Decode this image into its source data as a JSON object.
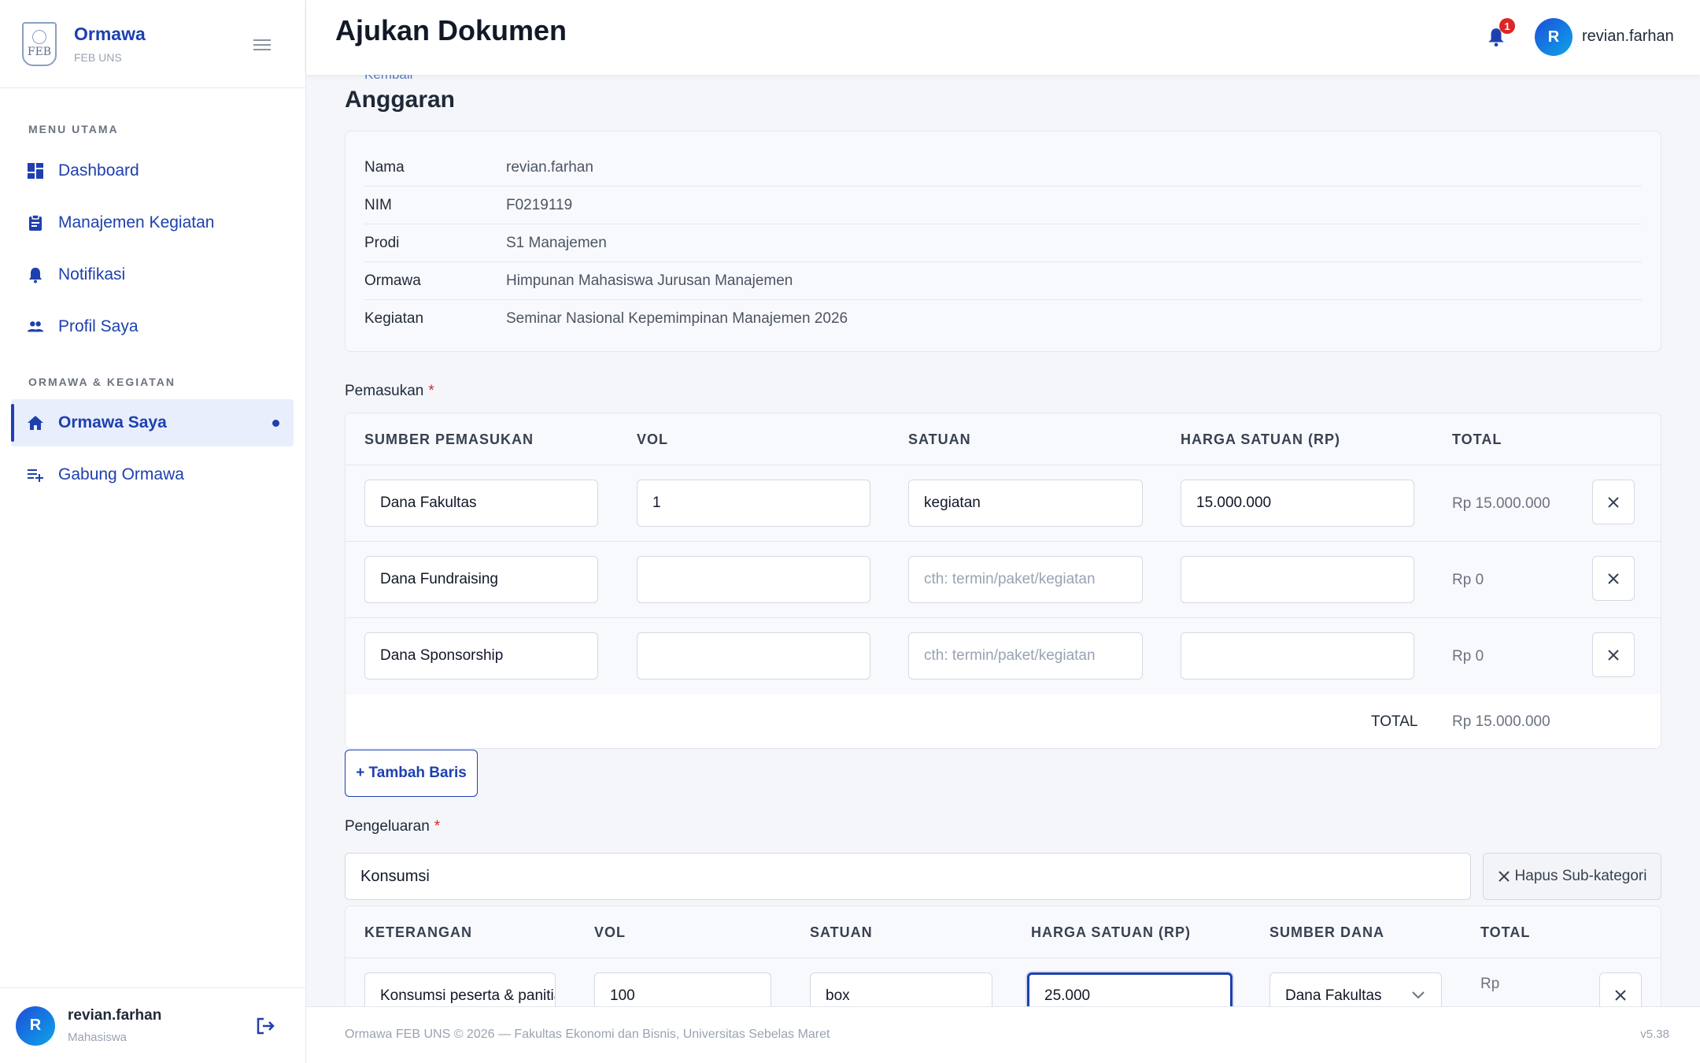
{
  "brand": {
    "name": "Ormawa",
    "sub": "FEB UNS",
    "logo_text": "FEB"
  },
  "sidebar": {
    "sections": [
      {
        "title": "MENU UTAMA"
      },
      {
        "title": "ORMAWA & KEGIATAN"
      }
    ],
    "items": [
      {
        "label": "Dashboard",
        "icon": "dashboard-icon"
      },
      {
        "label": "Manajemen Kegiatan",
        "icon": "clipboard-icon"
      },
      {
        "label": "Notifikasi",
        "icon": "bell-icon"
      },
      {
        "label": "Profil Saya",
        "icon": "people-icon"
      },
      {
        "label": "Ormawa Saya",
        "icon": "home-icon",
        "active": true
      },
      {
        "label": "Gabung Ormawa",
        "icon": "playlist-add-icon"
      }
    ],
    "user": {
      "initial": "R",
      "name": "revian.farhan",
      "role": "Mahasiswa"
    }
  },
  "header": {
    "title": "Ajukan Dokumen",
    "notification_count": "1",
    "user_initial": "R",
    "user_name": "revian.farhan"
  },
  "main": {
    "back_label": "Kembali",
    "section_title": "Anggaran",
    "info": [
      {
        "label": "Nama",
        "value": "revian.farhan"
      },
      {
        "label": "NIM",
        "value": "F0219119"
      },
      {
        "label": "Prodi",
        "value": "S1 Manajemen"
      },
      {
        "label": "Ormawa",
        "value": "Himpunan Mahasiswa Jurusan Manajemen"
      },
      {
        "label": "Kegiatan",
        "value": "Seminar Nasional Kepemimpinan Manajemen 2026"
      }
    ],
    "pemasukan": {
      "label": "Pemasukan",
      "required_mark": "*",
      "headers": [
        "SUMBER PEMASUKAN",
        "VOL",
        "SATUAN",
        "HARGA SATUAN (RP)",
        "TOTAL"
      ],
      "satuan_placeholder": "cth: termin/paket/kegiatan",
      "rows": [
        {
          "sumber": "Dana Fakultas",
          "vol": "1",
          "satuan": "kegiatan",
          "harga": "15.000.000",
          "total": "Rp 15.000.000"
        },
        {
          "sumber": "Dana Fundraising",
          "vol": "",
          "satuan": "",
          "harga": "",
          "total": "Rp 0"
        },
        {
          "sumber": "Dana Sponsorship",
          "vol": "",
          "satuan": "",
          "harga": "",
          "total": "Rp 0"
        }
      ],
      "total_label": "TOTAL",
      "total_value": "Rp 15.000.000",
      "add_button": "+ Tambah Baris"
    },
    "pengeluaran": {
      "label": "Pengeluaran",
      "required_mark": "*",
      "subcategory": "Konsumsi",
      "remove_subcategory": "Hapus Sub-kategori",
      "headers": [
        "KETERANGAN",
        "VOL",
        "SATUAN",
        "HARGA SATUAN (RP)",
        "SUMBER DANA",
        "TOTAL"
      ],
      "rows": [
        {
          "keterangan": "Konsumsi peserta & panitia",
          "vol": "100",
          "satuan": "box",
          "harga": "25.000",
          "sumber_dana": "Dana Fakultas",
          "total": "Rp"
        }
      ]
    }
  },
  "footer": {
    "text": "Ormawa FEB UNS © 2026 — Fakultas Ekonomi dan Bisnis, Universitas Sebelas Maret",
    "version": "v5.38"
  },
  "colors": {
    "primary": "#1e40af",
    "danger": "#dc2626",
    "background": "#f4f6fa"
  }
}
